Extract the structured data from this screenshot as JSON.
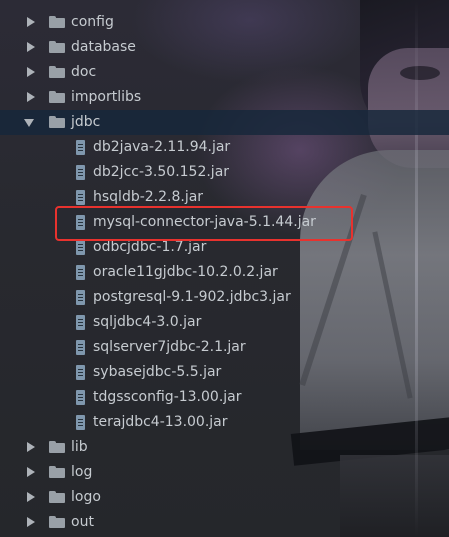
{
  "tree": {
    "top_folders": [
      {
        "label": "config"
      },
      {
        "label": "database"
      },
      {
        "label": "doc"
      },
      {
        "label": "importlibs"
      }
    ],
    "jdbc": {
      "label": "jdbc",
      "files": [
        {
          "label": "db2java-2.11.94.jar"
        },
        {
          "label": "db2jcc-3.50.152.jar"
        },
        {
          "label": "hsqldb-2.2.8.jar"
        },
        {
          "label": "mysql-connector-java-5.1.44.jar"
        },
        {
          "label": "odbcjdbc-1.7.jar"
        },
        {
          "label": "oracle11gjdbc-10.2.0.2.jar"
        },
        {
          "label": "postgresql-9.1-902.jdbc3.jar"
        },
        {
          "label": "sqljdbc4-3.0.jar"
        },
        {
          "label": "sqlserver7jdbc-2.1.jar"
        },
        {
          "label": "sybasejdbc-5.5.jar"
        },
        {
          "label": "tdgssconfig-13.00.jar"
        },
        {
          "label": "terajdbc4-13.00.jar"
        }
      ]
    },
    "bottom_folders": [
      {
        "label": "lib"
      },
      {
        "label": "log"
      },
      {
        "label": "logo"
      },
      {
        "label": "out"
      }
    ]
  },
  "icons": {
    "folder": "folder-icon",
    "jar": "jar-file-icon",
    "collapsed": "chevron-right-icon",
    "expanded": "chevron-down-icon"
  },
  "colors": {
    "text": "#c6cbd0",
    "selection": "#16273a",
    "highlight_box": "#e8322e",
    "folder_icon": "#99a0a7",
    "jar_icon": "#7f97ad"
  }
}
